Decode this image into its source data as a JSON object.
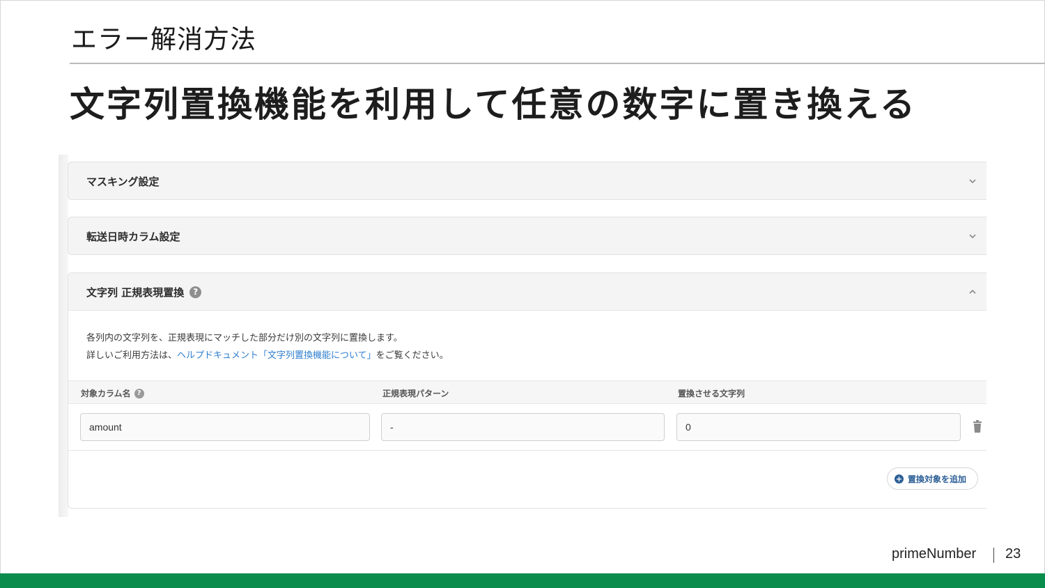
{
  "slide": {
    "section_title": "エラー解消方法",
    "headline": "文字列置換機能を利用して任意の数字に置き換える",
    "brand": "primeNumber",
    "page_number": "23",
    "accent_color": "#0a8c4d"
  },
  "settings": {
    "masking": {
      "label": "マスキング設定",
      "state": "collapsed",
      "icon": "chevron-down-icon"
    },
    "transfer_datetime": {
      "label": "転送日時カラム設定",
      "state": "collapsed",
      "icon": "chevron-down-icon"
    },
    "regex_replace": {
      "label": "文字列 正規表現置換",
      "help": "?",
      "state": "expanded",
      "icon": "chevron-up-icon",
      "description_line1": "各列内の文字列を、正規表現にマッチした部分だけ別の文字列に置換します。",
      "description_prefix": "詳しいご利用方法は、",
      "description_link": "ヘルプドキュメント「文字列置換機能について」",
      "description_suffix": "をご覧ください。",
      "link_color": "#2f7fd1",
      "columns": {
        "target_column": "対象カラム名",
        "regex_pattern": "正規表現パターン",
        "replacement": "置換させる文字列"
      },
      "row": {
        "target_column": "amount",
        "regex_pattern": "-",
        "replacement": "0"
      },
      "add_button": "置換対象を追加"
    }
  }
}
